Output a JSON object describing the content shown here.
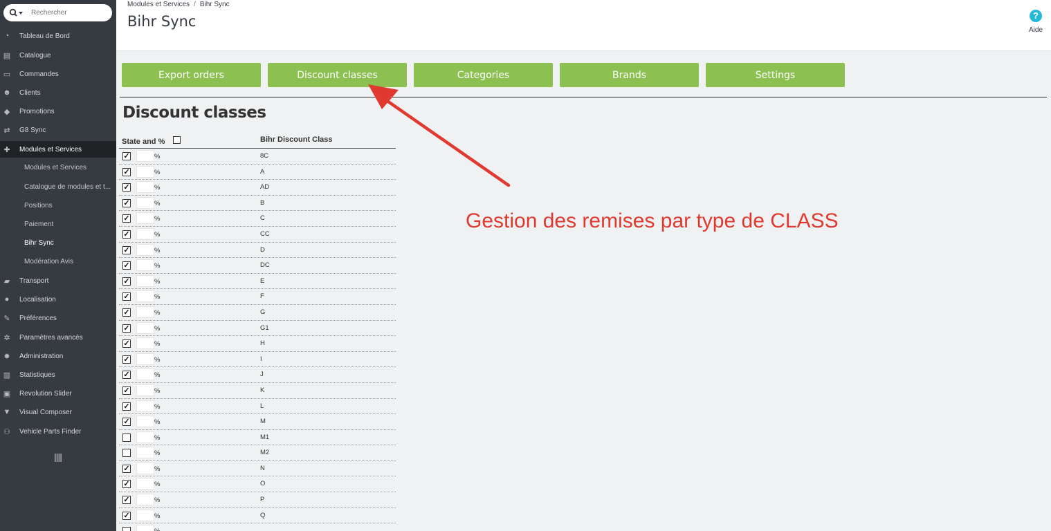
{
  "search": {
    "placeholder": "Rechercher"
  },
  "sidebar": {
    "items": [
      {
        "label": "Tableau de Bord",
        "icon": "dashboard-icon"
      },
      {
        "label": "Catalogue",
        "icon": "book-icon"
      },
      {
        "label": "Commandes",
        "icon": "credit-card-icon"
      },
      {
        "label": "Clients",
        "icon": "users-icon"
      },
      {
        "label": "Promotions",
        "icon": "tags-icon"
      },
      {
        "label": "G8 Sync",
        "icon": "exchange-icon"
      },
      {
        "label": "Modules et Services",
        "icon": "puzzle-icon"
      },
      {
        "label": "Transport",
        "icon": "truck-icon"
      },
      {
        "label": "Localisation",
        "icon": "globe-icon"
      },
      {
        "label": "Préférences",
        "icon": "wrench-icon"
      },
      {
        "label": "Paramètres avancés",
        "icon": "cogs-icon"
      },
      {
        "label": "Administration",
        "icon": "cog-icon"
      },
      {
        "label": "Statistiques",
        "icon": "bar-chart-icon"
      },
      {
        "label": "Revolution Slider",
        "icon": "image-icon"
      },
      {
        "label": "Visual Composer",
        "icon": "vc-icon"
      },
      {
        "label": "Vehicle Parts Finder",
        "icon": "motorcycle-icon"
      }
    ],
    "subitems": [
      {
        "label": "Modules et Services"
      },
      {
        "label": "Catalogue de modules et t..."
      },
      {
        "label": "Positions"
      },
      {
        "label": "Paiement"
      },
      {
        "label": "Bihr Sync"
      },
      {
        "label": "Modération Avis"
      }
    ]
  },
  "header": {
    "breadcrumb": [
      "Modules et Services",
      "Bihr Sync"
    ],
    "title": "Bihr Sync",
    "help_label": "Aide"
  },
  "tabs": [
    "Export orders",
    "Discount classes",
    "Categories",
    "Brands",
    "Settings"
  ],
  "section": {
    "title": "Discount classes"
  },
  "table": {
    "col1": "State and %",
    "col2": "Bihr Discount Class",
    "pct_sign": "%",
    "rows": [
      {
        "cls": "8C",
        "checked": true
      },
      {
        "cls": "A",
        "checked": true
      },
      {
        "cls": "AD",
        "checked": true
      },
      {
        "cls": "B",
        "checked": true
      },
      {
        "cls": "C",
        "checked": true
      },
      {
        "cls": "CC",
        "checked": true
      },
      {
        "cls": "D",
        "checked": true
      },
      {
        "cls": "DC",
        "checked": true
      },
      {
        "cls": "E",
        "checked": true
      },
      {
        "cls": "F",
        "checked": true
      },
      {
        "cls": "G",
        "checked": true
      },
      {
        "cls": "G1",
        "checked": true
      },
      {
        "cls": "H",
        "checked": true
      },
      {
        "cls": "I",
        "checked": true
      },
      {
        "cls": "J",
        "checked": true
      },
      {
        "cls": "K",
        "checked": true
      },
      {
        "cls": "L",
        "checked": true
      },
      {
        "cls": "M",
        "checked": true
      },
      {
        "cls": "M1",
        "checked": false
      },
      {
        "cls": "M2",
        "checked": false
      },
      {
        "cls": "N",
        "checked": true
      },
      {
        "cls": "O",
        "checked": true
      },
      {
        "cls": "P",
        "checked": true
      },
      {
        "cls": "Q",
        "checked": true
      },
      {
        "cls": "",
        "checked": false
      }
    ]
  },
  "annotation": {
    "text": "Gestion des remises par type de CLASS",
    "color": "#e03a30"
  },
  "colors": {
    "sidebar": "#363a41",
    "active": "#202226",
    "tab": "#8cc152",
    "help": "#25b9d7"
  }
}
